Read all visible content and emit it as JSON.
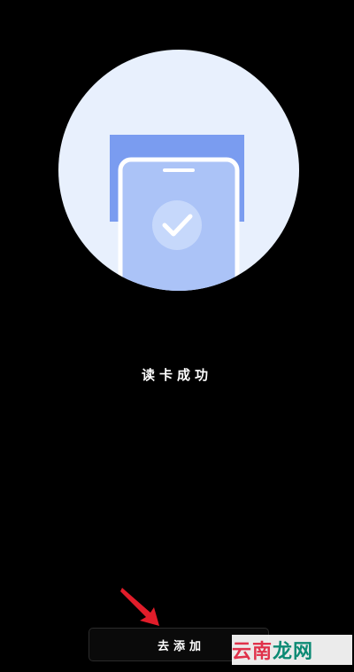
{
  "status": {
    "text": "读卡成功"
  },
  "action": {
    "add_label": "去添加"
  },
  "watermark": {
    "part1": "云南",
    "part2": "龙网"
  },
  "colors": {
    "background": "#000000",
    "circle": "#e8f0fd",
    "card": "#7a9cf0",
    "phone_screen": "#abc3f7",
    "check_bg": "#c6d8fb",
    "arrow": "#e11d2a"
  },
  "icons": {
    "illustration": "phone-card-check-icon",
    "arrow": "red-arrow-icon"
  }
}
